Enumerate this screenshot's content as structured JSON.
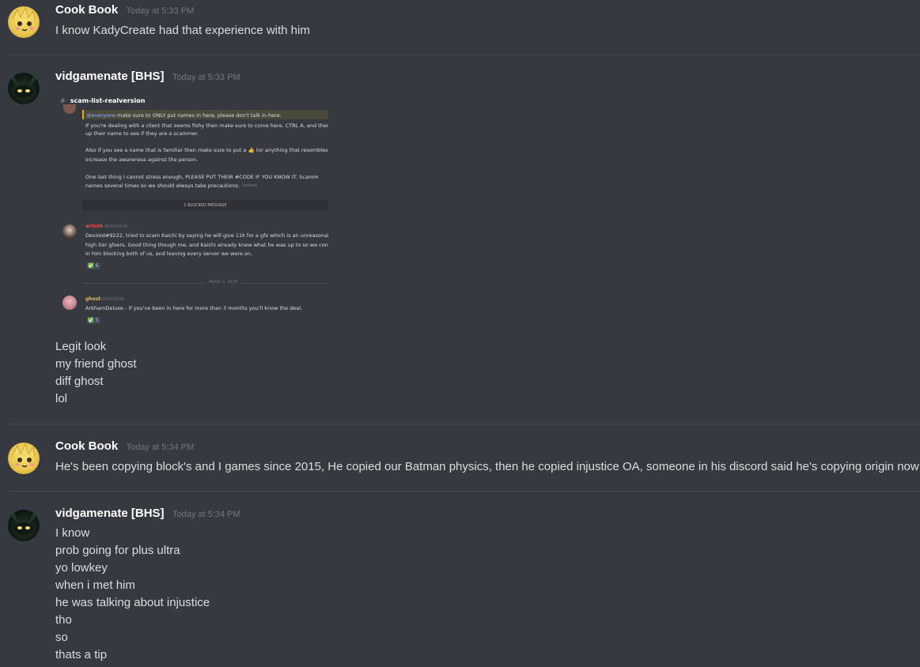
{
  "messages": [
    {
      "username": "Cook Book",
      "timestamp": "Today at 5:33 PM",
      "avatar_icon": "cookbook-avatar",
      "lines": [
        "I know KadyCreate had that experience with him"
      ]
    },
    {
      "username": "vidgamenate [BHS]",
      "timestamp": "Today at 5:33 PM",
      "avatar_icon": "vidgamenate-avatar",
      "attachment": {
        "channel": "scam-list-realversion",
        "everyone_mention": "@everyone",
        "pinned_lines": [
          "make sure to ONLY put names in here, please don't talk in here.",
          "If you're dealing with a client that seems fishy then make sure to come here, CTRL A, and then",
          "up their name to see if they are a scammer.",
          "Also if you see a name that is familiar then make sure to put a 👍 (or anything that resembles",
          "increase the awareness against the person.",
          "One last thing I cannot stress enough, PLEASE PUT THEIR #CODE IF YOU KNOW IT. Scamm",
          "names several times so we should always take precautions."
        ],
        "edited": "(edited)",
        "blocked_message": "1 BLOCKED MESSAGE",
        "post1": {
          "author": "ariloth",
          "date": "06/06/2018",
          "lines": [
            "Desired#9222, tried to scam Kaichi by saying he will give 11k for a gfx which is an unreasonab",
            "high tier gfxers. Good thing though me, and Kaichi already knew what he was up to so we con",
            "in him blocking both of us, and leaving every server we were on."
          ],
          "reaction": "✅ 6"
        },
        "date_separator": "March 3, 2019",
        "post2": {
          "author": "ghost",
          "date": "03/03/2019",
          "lines": [
            "ArkhamDeluxe - If you've been in here for more than 3 months you'll know the  deal."
          ],
          "reaction": "✅ 5"
        }
      },
      "lines": [
        "Legit look",
        "my friend ghost",
        "diff ghost",
        "lol"
      ]
    },
    {
      "username": "Cook Book",
      "timestamp": "Today at 5:34 PM",
      "avatar_icon": "cookbook-avatar",
      "lines": [
        "He's been copying block's and I games since 2015, He copied our Batman physics, then he copied injustice OA, someone in his discord said he's copying origin now"
      ]
    },
    {
      "username": "vidgamenate [BHS]",
      "timestamp": "Today at 5:34 PM",
      "avatar_icon": "vidgamenate-avatar",
      "lines": [
        "I know",
        "prob going for plus ultra",
        "yo lowkey",
        "when i met him",
        "he was talking about injustice",
        "tho",
        "so",
        "thats a tip"
      ]
    }
  ],
  "colors": {
    "background": "#36393f",
    "username": "#ffffff",
    "timestamp": "#72767d",
    "text": "#dcddde",
    "divider": "#42454a"
  }
}
